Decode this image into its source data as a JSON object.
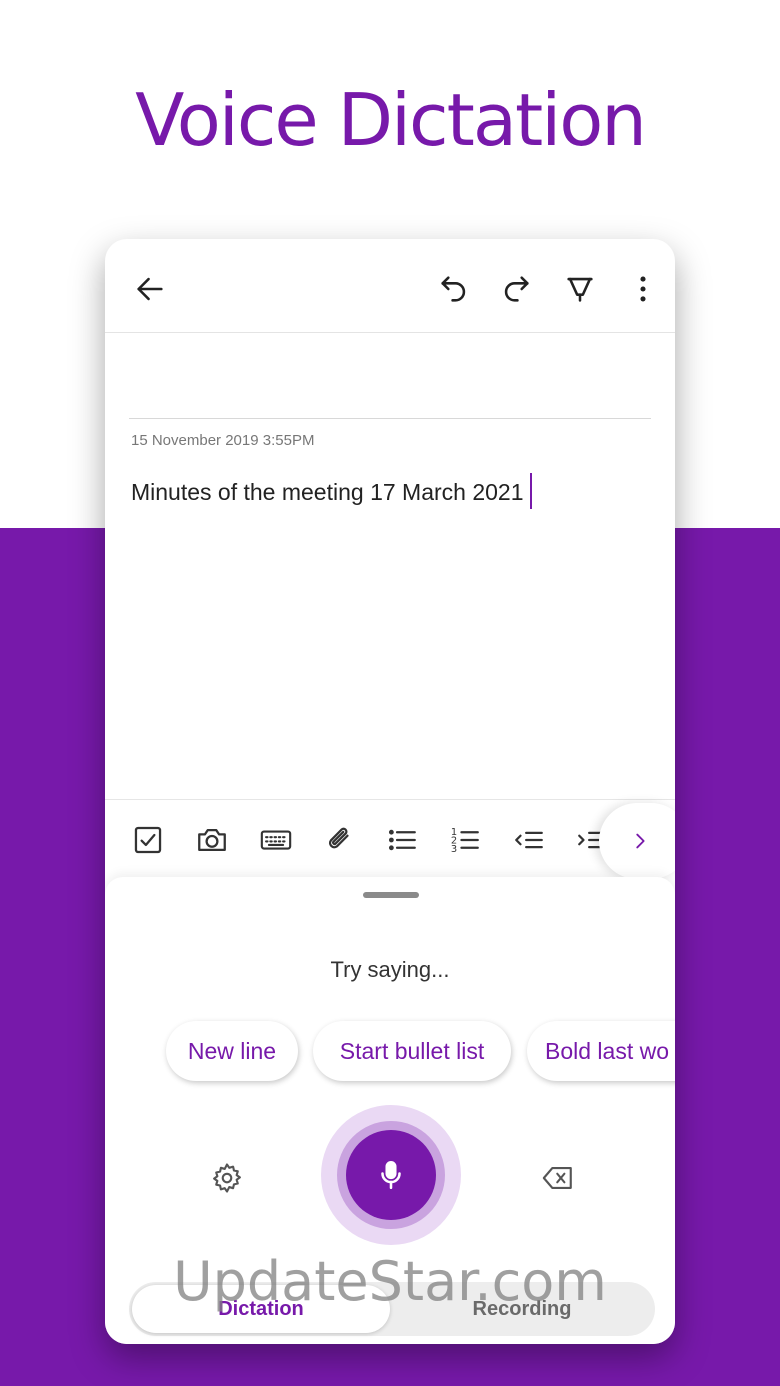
{
  "headline": "Voice Dictation",
  "note": {
    "date": "15 November 2019 3:55PM",
    "body": "Minutes of the meeting 17 March 2021"
  },
  "appbar": {
    "icons": [
      "back-arrow-icon",
      "undo-icon",
      "redo-icon",
      "pen-icon",
      "more-vertical-icon"
    ]
  },
  "format_toolbar": {
    "icons": [
      "checkbox-icon",
      "camera-icon",
      "keyboard-icon",
      "attach-icon",
      "bullet-list-icon",
      "numbered-list-icon",
      "outdent-icon",
      "indent-icon",
      "chevron-right-icon"
    ]
  },
  "dictation": {
    "prompt": "Try saying...",
    "chips": [
      "New line",
      "Start bullet list",
      "Bold last wo"
    ],
    "tabs": {
      "active": "Dictation",
      "inactive": "Recording"
    }
  },
  "watermark": "UpdateStar.com",
  "colors": {
    "accent": "#7719aa",
    "background_lower": "#7719aa",
    "mic_halo": "#ead9f4"
  }
}
